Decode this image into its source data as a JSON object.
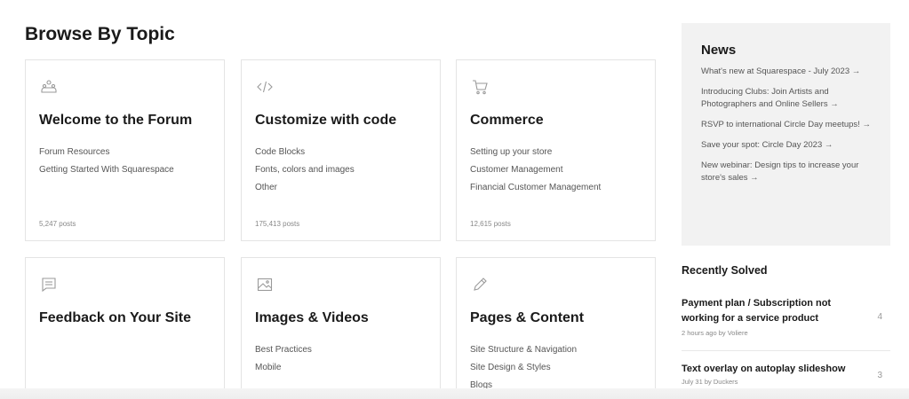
{
  "page": {
    "title": "Browse By Topic"
  },
  "topics": [
    {
      "icon": "community-icon",
      "title": "Welcome to the Forum",
      "links": [
        "Forum Resources",
        "Getting Started With Squarespace"
      ],
      "posts": "5,247 posts"
    },
    {
      "icon": "code-icon",
      "title": "Customize with code",
      "links": [
        "Code Blocks",
        "Fonts, colors and images",
        "Other"
      ],
      "posts": "175,413 posts"
    },
    {
      "icon": "cart-icon",
      "title": "Commerce",
      "links": [
        "Setting up your store",
        "Customer Management",
        "Financial Customer Management"
      ],
      "posts": "12,615 posts"
    },
    {
      "icon": "chat-icon",
      "title": "Feedback on Your Site",
      "links": []
    },
    {
      "icon": "image-icon",
      "title": "Images & Videos",
      "links": [
        "Best Practices",
        "Mobile"
      ]
    },
    {
      "icon": "pencil-icon",
      "title": "Pages & Content",
      "links": [
        "Site Structure & Navigation",
        "Site Design & Styles",
        "Blogs"
      ]
    }
  ],
  "news": {
    "title": "News",
    "items": [
      "What's new at Squarespace - July 2023 →",
      "Introducing Clubs: Join Artists and Photographers and Online Sellers →",
      "RSVP to international Circle Day meetups! →",
      "Save your spot: Circle Day 2023 →",
      "New webinar: Design tips to increase your store's sales →"
    ]
  },
  "recently_solved": {
    "title": "Recently Solved",
    "items": [
      {
        "question": "Payment plan / Subscription not working for a service product",
        "meta": "2 hours ago by Voliere",
        "count": "4"
      },
      {
        "question": "Text overlay on autoplay slideshow",
        "meta": "July 31 by Duckers",
        "count": "3"
      }
    ]
  }
}
